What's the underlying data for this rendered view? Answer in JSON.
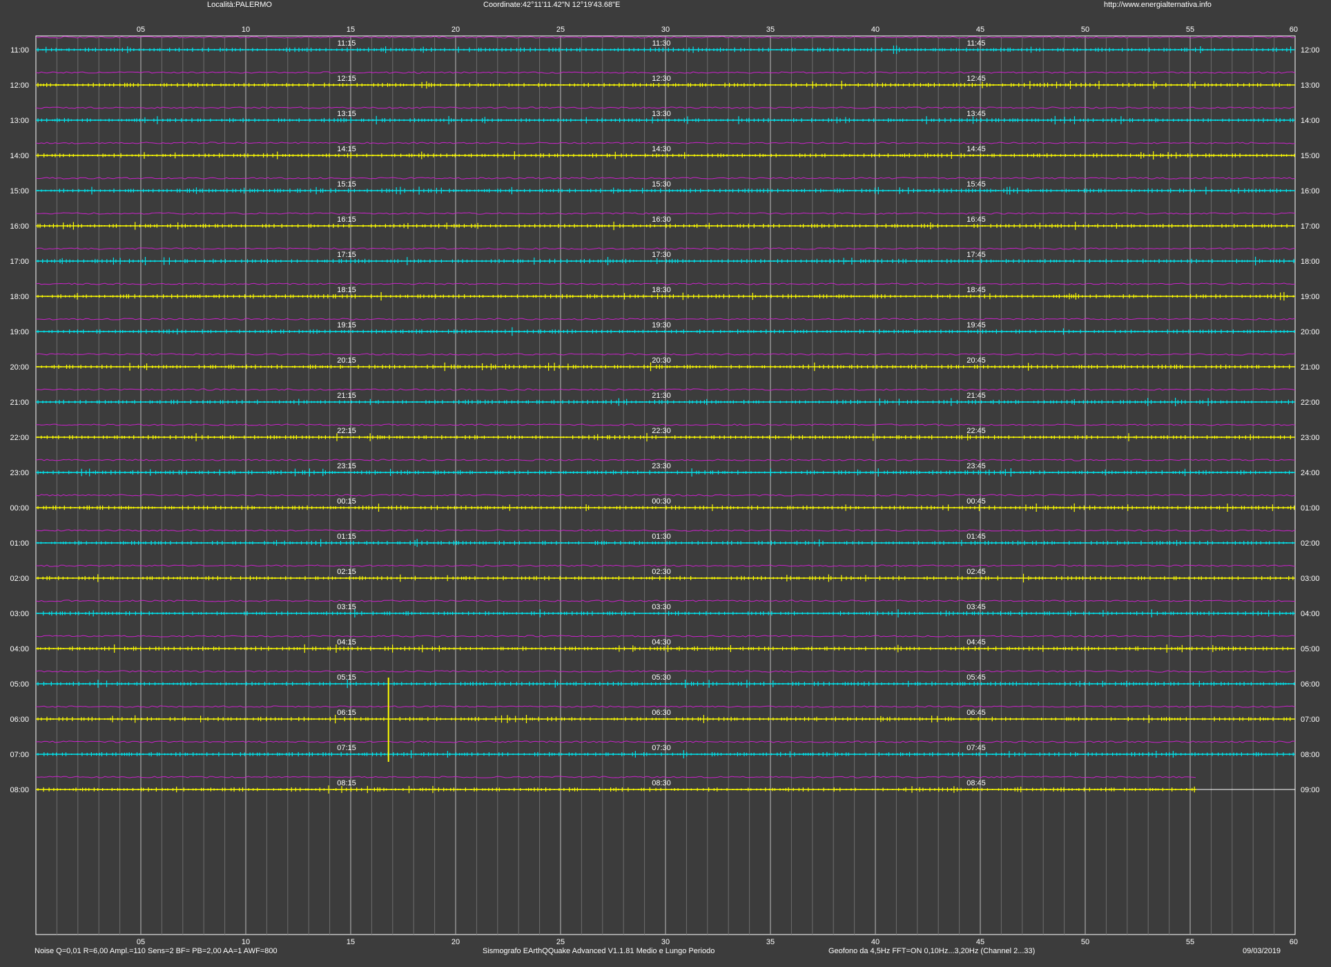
{
  "header": {
    "location": "Località:PALERMO",
    "coordinates": "Coordinate:42°11'11.42\"N  12°19'43.68\"E",
    "website": "http://www.energialternativa.info"
  },
  "footer": {
    "settings": "Noise Q=0,01 R=6,00 Ampl.=110 Sens=2 BF= PB=2,00 AA=1 AWF=800",
    "software": "Sismografo  EArthQQuake Advanced V1.1.81  Medio e Lungo Periodo",
    "sensor": "Geofono da 4,5Hz FFT=ON 0,10Hz...3,20Hz     (Channel 2...33)",
    "date": "09/03/2019"
  },
  "colors": {
    "background": "#3c3c3c",
    "trace_a": "#00e5ee",
    "trace_b": "#ffff00",
    "noise_trace": "#cc22cc",
    "grid_major": "#bdbdbd",
    "grid_minor": "#6e6e6e"
  },
  "chart_data": {
    "type": "line",
    "x_axis": {
      "unit": "minutes",
      "range": [
        0,
        60
      ],
      "ticks": [
        "05",
        "10",
        "15",
        "20",
        "25",
        "30",
        "35",
        "40",
        "45",
        "50",
        "55",
        "60"
      ]
    },
    "rows": [
      {
        "start": "11:00",
        "end": "12:00",
        "marks": [
          "11:15",
          "11:30",
          "11:45"
        ],
        "color": "cyan"
      },
      {
        "start": "12:00",
        "end": "13:00",
        "marks": [
          "12:15",
          "12:30",
          "12:45"
        ],
        "color": "yellow"
      },
      {
        "start": "13:00",
        "end": "14:00",
        "marks": [
          "13:15",
          "13:30",
          "13:45"
        ],
        "color": "cyan"
      },
      {
        "start": "14:00",
        "end": "15:00",
        "marks": [
          "14:15",
          "14:30",
          "14:45"
        ],
        "color": "yellow"
      },
      {
        "start": "15:00",
        "end": "16:00",
        "marks": [
          "15:15",
          "15:30",
          "15:45"
        ],
        "color": "cyan"
      },
      {
        "start": "16:00",
        "end": "17:00",
        "marks": [
          "16:15",
          "16:30",
          "16:45"
        ],
        "color": "yellow"
      },
      {
        "start": "17:00",
        "end": "18:00",
        "marks": [
          "17:15",
          "17:30",
          "17:45"
        ],
        "color": "cyan"
      },
      {
        "start": "18:00",
        "end": "19:00",
        "marks": [
          "18:15",
          "18:30",
          "18:45"
        ],
        "color": "yellow"
      },
      {
        "start": "19:00",
        "end": "20:00",
        "marks": [
          "19:15",
          "19:30",
          "19:45"
        ],
        "color": "cyan"
      },
      {
        "start": "20:00",
        "end": "21:00",
        "marks": [
          "20:15",
          "20:30",
          "20:45"
        ],
        "color": "yellow"
      },
      {
        "start": "21:00",
        "end": "22:00",
        "marks": [
          "21:15",
          "21:30",
          "21:45"
        ],
        "color": "cyan"
      },
      {
        "start": "22:00",
        "end": "23:00",
        "marks": [
          "22:15",
          "22:30",
          "22:45"
        ],
        "color": "yellow"
      },
      {
        "start": "23:00",
        "end": "24:00",
        "marks": [
          "23:15",
          "23:30",
          "23:45"
        ],
        "color": "cyan"
      },
      {
        "start": "00:00",
        "end": "01:00",
        "marks": [
          "00:15",
          "00:30",
          "00:45"
        ],
        "color": "yellow"
      },
      {
        "start": "01:00",
        "end": "02:00",
        "marks": [
          "01:15",
          "01:30",
          "01:45"
        ],
        "color": "cyan"
      },
      {
        "start": "02:00",
        "end": "03:00",
        "marks": [
          "02:15",
          "02:30",
          "02:45"
        ],
        "color": "yellow"
      },
      {
        "start": "03:00",
        "end": "04:00",
        "marks": [
          "03:15",
          "03:30",
          "03:45"
        ],
        "color": "cyan"
      },
      {
        "start": "04:00",
        "end": "05:00",
        "marks": [
          "04:15",
          "04:30",
          "04:45"
        ],
        "color": "yellow"
      },
      {
        "start": "05:00",
        "end": "06:00",
        "marks": [
          "05:15",
          "05:30",
          "05:45"
        ],
        "color": "cyan"
      },
      {
        "start": "06:00",
        "end": "07:00",
        "marks": [
          "06:15",
          "06:30",
          "06:45"
        ],
        "color": "yellow"
      },
      {
        "start": "07:00",
        "end": "08:00",
        "marks": [
          "07:15",
          "07:30",
          "07:45"
        ],
        "color": "cyan"
      },
      {
        "start": "08:00",
        "end": "09:00",
        "marks": [
          "08:15",
          "08:30",
          "08:45"
        ],
        "color": "yellow",
        "recorded_until_minute": 55.3
      }
    ],
    "events": [
      {
        "row": "06:00",
        "minute": 16.8,
        "type": "spike"
      }
    ]
  }
}
